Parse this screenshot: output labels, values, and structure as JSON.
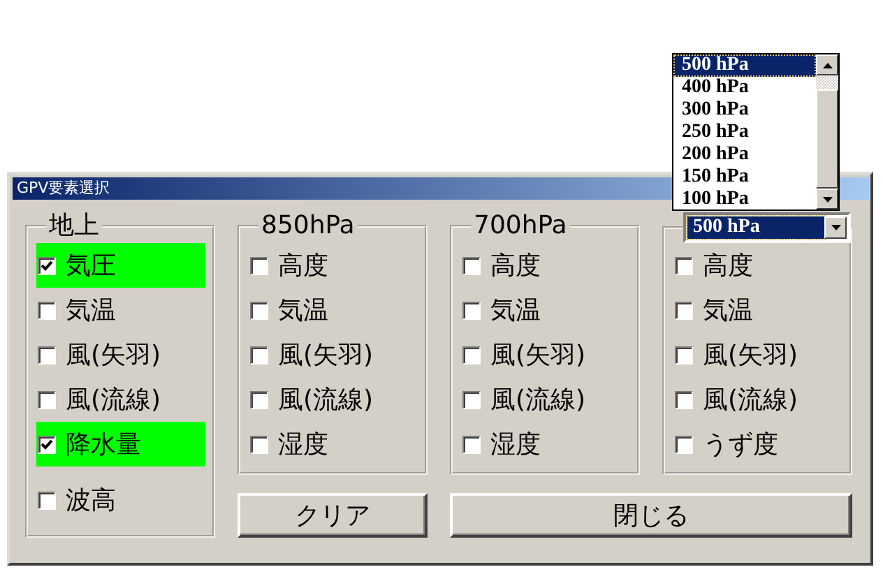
{
  "window": {
    "title": "GPV要素選択"
  },
  "groups": [
    {
      "kind": "label",
      "label": "地上",
      "items": [
        {
          "label": "気圧",
          "checked": true
        },
        {
          "label": "気温",
          "checked": false
        },
        {
          "label": "風(矢羽)",
          "checked": false
        },
        {
          "label": "風(流線)",
          "checked": false
        },
        {
          "label": "降水量",
          "checked": true
        },
        {
          "label": "波高",
          "checked": false
        }
      ]
    },
    {
      "kind": "label",
      "label": "850hPa",
      "items": [
        {
          "label": "高度",
          "checked": false
        },
        {
          "label": "気温",
          "checked": false
        },
        {
          "label": "風(矢羽)",
          "checked": false
        },
        {
          "label": "風(流線)",
          "checked": false
        },
        {
          "label": "湿度",
          "checked": false
        }
      ]
    },
    {
      "kind": "label",
      "label": "700hPa",
      "items": [
        {
          "label": "高度",
          "checked": false
        },
        {
          "label": "気温",
          "checked": false
        },
        {
          "label": "風(矢羽)",
          "checked": false
        },
        {
          "label": "風(流線)",
          "checked": false
        },
        {
          "label": "湿度",
          "checked": false
        }
      ]
    },
    {
      "kind": "combo",
      "value": "500 hPa",
      "items": [
        {
          "label": "高度",
          "checked": false
        },
        {
          "label": "気温",
          "checked": false
        },
        {
          "label": "風(矢羽)",
          "checked": false
        },
        {
          "label": "風(流線)",
          "checked": false
        },
        {
          "label": "うず度",
          "checked": false
        }
      ]
    }
  ],
  "dropdown": {
    "options": [
      {
        "label": "500 hPa",
        "selected": true
      },
      {
        "label": "400 hPa",
        "selected": false
      },
      {
        "label": "300 hPa",
        "selected": false
      },
      {
        "label": "250 hPa",
        "selected": false
      },
      {
        "label": "200 hPa",
        "selected": false
      },
      {
        "label": "150 hPa",
        "selected": false
      },
      {
        "label": "100 hPa",
        "selected": false
      }
    ]
  },
  "buttons": [
    {
      "label": "クリア"
    },
    {
      "label": "閉じる"
    }
  ]
}
